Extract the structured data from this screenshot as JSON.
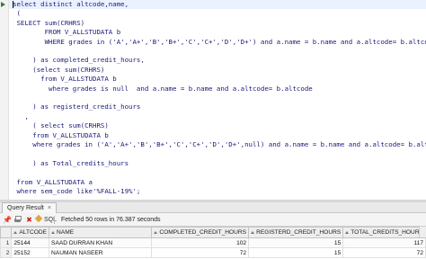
{
  "editor": {
    "lines": [
      {
        "text": "select distinct altcode,name,"
      },
      {
        "text": " ("
      },
      {
        "text": " SELECT sum(CRHRS)"
      },
      {
        "text": "        FROM V_ALLSTUDATA b"
      },
      {
        "text": "        WHERE grades in ('A','A+','B','B+','C','C+','D','D+') and a.name = b.name and a.altcode= b.altcode"
      },
      {
        "text": ""
      },
      {
        "text": "     ) as completed_credit_hours,"
      },
      {
        "text": "     (select sum(CRHRS)"
      },
      {
        "text": "       from V_ALLSTUDATA b"
      },
      {
        "text": "         where grades is null  and a.name = b.name and a.altcode= b.altcode"
      },
      {
        "text": ""
      },
      {
        "text": "     ) as registerd_credit_hours"
      },
      {
        "text": "   ,"
      },
      {
        "text": "     ( select sum(CRHRS)"
      },
      {
        "text": "     from V_ALLSTUDATA b"
      },
      {
        "text": "     where grades in ('A','A+','B','B+','C','C+','D','D+',null) and a.name = b.name and a.altcode= b.altcode"
      },
      {
        "text": ""
      },
      {
        "text": "     ) as Total_credits_hours"
      },
      {
        "text": ""
      },
      {
        "text": " from V_ALLSTUDATA a"
      },
      {
        "text": " where sem_code like'%FALL-19%';"
      }
    ]
  },
  "result_tab": {
    "label": "Query Result",
    "close": "×"
  },
  "toolbar": {
    "pin_glyph": "📌",
    "delete_glyph": "✖",
    "sql_label": "SQL",
    "status": "Fetched 50 rows in 76.387 seconds"
  },
  "grid": {
    "columns": [
      "ALTCODE",
      "NAME",
      "COMPLETED_CREDIT_HOURS",
      "REGISTERD_CREDIT_HOURS",
      "TOTAL_CREDITS_HOURS"
    ],
    "rows": [
      {
        "num": "1",
        "altcode": "25144",
        "name": "SAAD DURRAN KHAN",
        "completed": "102",
        "registered": "15",
        "total": "117"
      },
      {
        "num": "2",
        "altcode": "25152",
        "name": "NAUMAN NASEER",
        "completed": "72",
        "registered": "15",
        "total": "72"
      }
    ]
  }
}
